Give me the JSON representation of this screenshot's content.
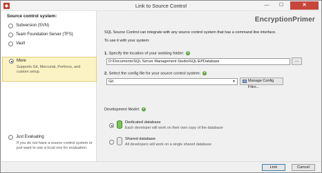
{
  "window": {
    "title": "Link to Source Control",
    "minimize": "—",
    "maximize": "☐",
    "close": "✕"
  },
  "sidebar": {
    "heading": "Source control system:",
    "options": [
      {
        "label": "Subversion (SVN)",
        "selected": false
      },
      {
        "label": "Team Foundation Server (TFS)",
        "selected": false
      },
      {
        "label": "Vault",
        "selected": false
      },
      {
        "label": "More",
        "selected": true,
        "description": "Supports Git, Mercurial, Perforce, and custom setup."
      },
      {
        "label": "Just Evaluating",
        "selected": false,
        "description": "If you do not have a source control system or just want to use a local one for evaluation."
      }
    ]
  },
  "main": {
    "logo": "EncryptionPrimer",
    "intro": "SQL Source Control can integrate with any source control system that has a command line interface.",
    "intro2": "To use it with your system:",
    "step1": {
      "number": "1.",
      "label": "Specify the location of your working folder:",
      "value": "D:\\Documents\\SQL Server Management Studio\\SQL\\EPDatabase",
      "browse": "..."
    },
    "step2": {
      "number": "2.",
      "label": "Select the config file for your source control system:",
      "value": "Git",
      "manage": "Manage Config Files..."
    },
    "dev_model": {
      "label": "Development Model:",
      "options": [
        {
          "title": "Dedicated database",
          "desc": "Each developer will work on their own copy of the database",
          "selected": true
        },
        {
          "title": "Shared database",
          "desc": "All developers will work on a single shared database",
          "selected": false
        }
      ]
    }
  },
  "footer": {
    "link": "Link",
    "cancel": "Cancel"
  }
}
